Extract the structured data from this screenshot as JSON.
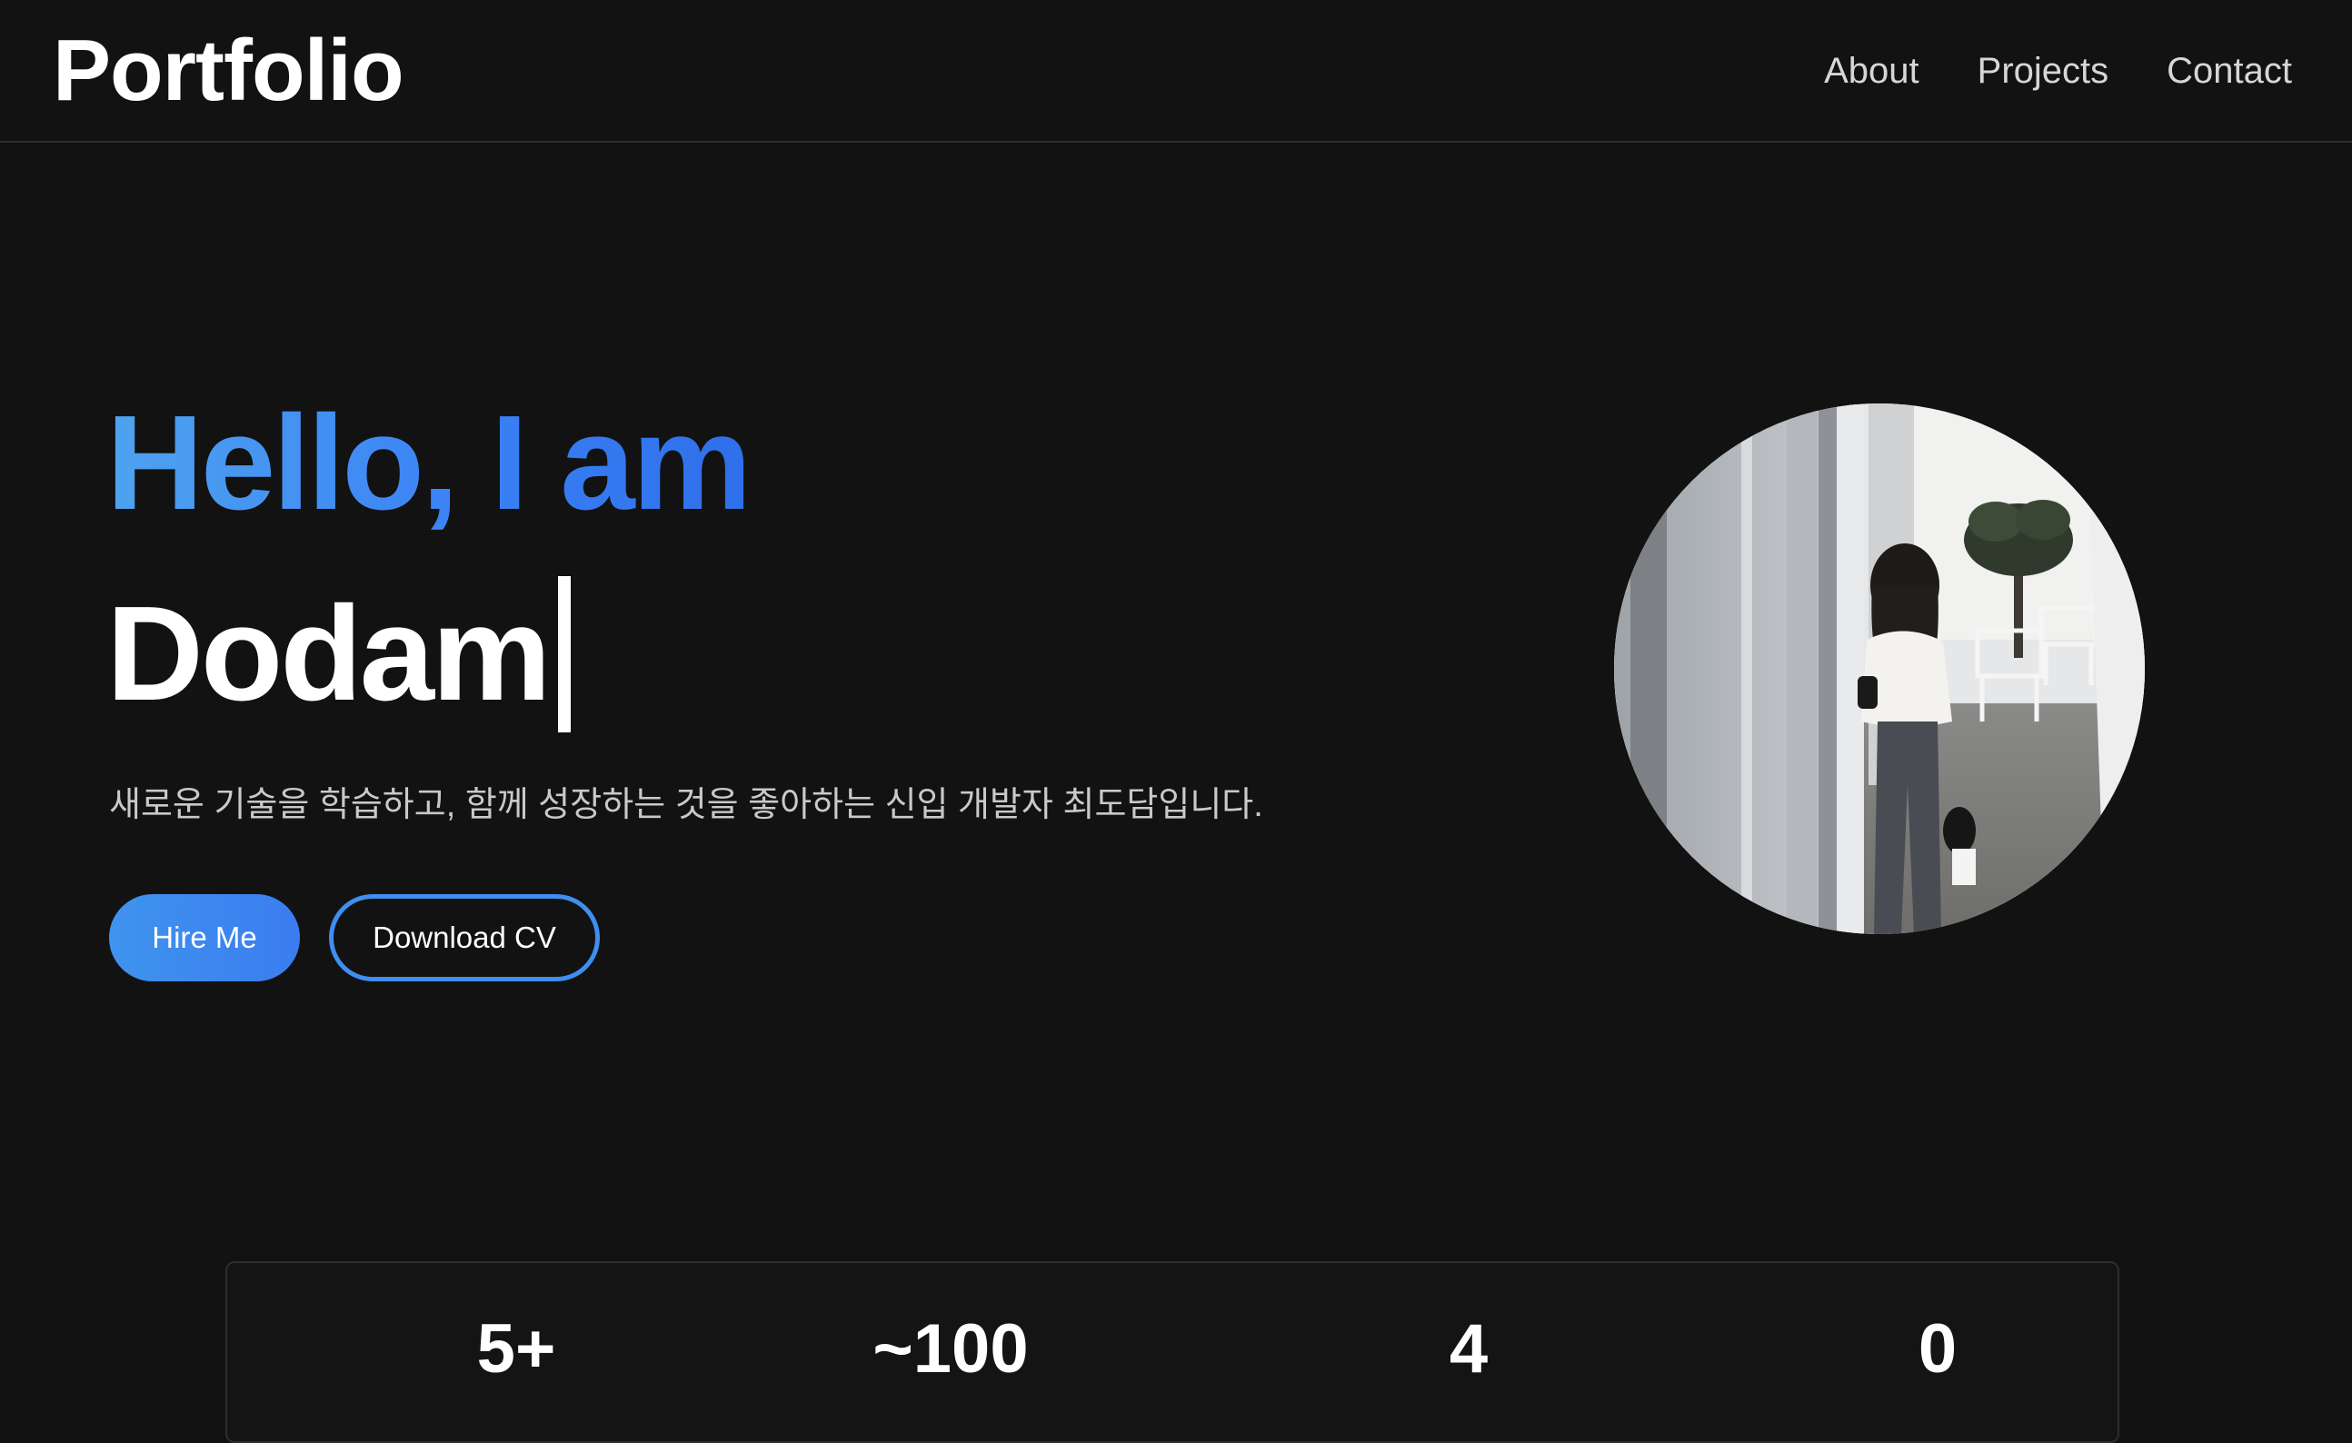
{
  "header": {
    "logo": "Portfolio",
    "nav": [
      "About",
      "Projects",
      "Contact"
    ]
  },
  "hero": {
    "greeting": "Hello, I am",
    "name": "Dodam",
    "description": "새로운 기술을 학습하고, 함께 성장하는 것을 좋아하는 신입 개발자 최도담입니다.",
    "primary_button": "Hire Me",
    "secondary_button": "Download CV"
  },
  "stats": [
    "5+",
    "~100",
    "4",
    "0"
  ],
  "colors": {
    "background": "#121212",
    "accent": "#3b82f6",
    "accent_light": "#4ea3ee",
    "text": "#ffffff",
    "muted_text": "#c9c9c9"
  }
}
